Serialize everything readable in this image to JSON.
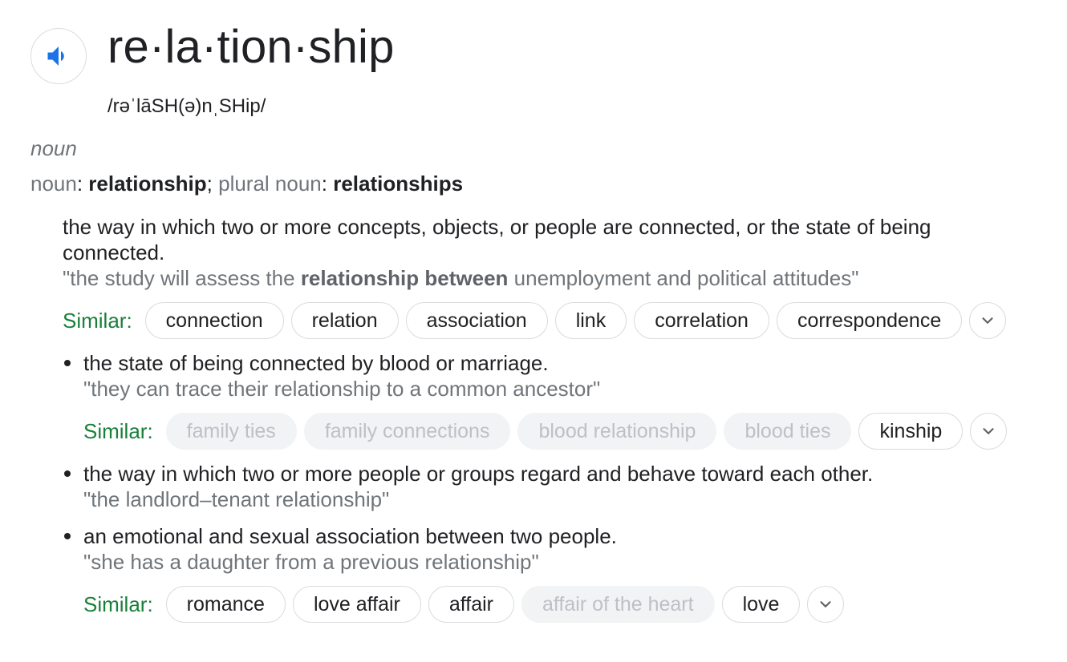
{
  "headword": "re·la·tion·ship",
  "phonetic": "/rəˈlāSH(ə)nˌSHip/",
  "part_of_speech": "noun",
  "forms": {
    "noun_label": "noun",
    "noun_sep": ": ",
    "noun_value": "relationship",
    "semi": "; ",
    "plural_label": "plural noun",
    "plural_sep": ": ",
    "plural_value": "relationships"
  },
  "senses": [
    {
      "definition": "the way in which two or more concepts, objects, or people are connected, or the state of being connected.",
      "example_pre": "\"the study will assess the ",
      "example_bold": "relationship between",
      "example_post": " unemployment and political attitudes\"",
      "similar_label": "Similar:",
      "similar": [
        "connection",
        "relation",
        "association",
        "link",
        "correlation",
        "correspondence"
      ]
    },
    {
      "definition": "the state of being connected by blood or marriage.",
      "example": "\"they can trace their relationship to a common ancestor\"",
      "similar_label": "Similar:",
      "similar_dim": [
        "family ties",
        "family connections",
        "blood relationship",
        "blood ties"
      ],
      "similar": [
        "kinship"
      ]
    },
    {
      "definition": "the way in which two or more people or groups regard and behave toward each other.",
      "example": "\"the landlord–tenant relationship\""
    },
    {
      "definition": "an emotional and sexual association between two people.",
      "example": "\"she has a daughter from a previous relationship\"",
      "similar_label": "Similar:",
      "similar_a": [
        "romance",
        "love affair",
        "affair"
      ],
      "similar_dim": [
        "affair of the heart"
      ],
      "similar_b": [
        "love"
      ]
    }
  ],
  "colors": {
    "similar_label": "#188038",
    "speaker": "#1a73e8",
    "muted": "#70757a"
  }
}
